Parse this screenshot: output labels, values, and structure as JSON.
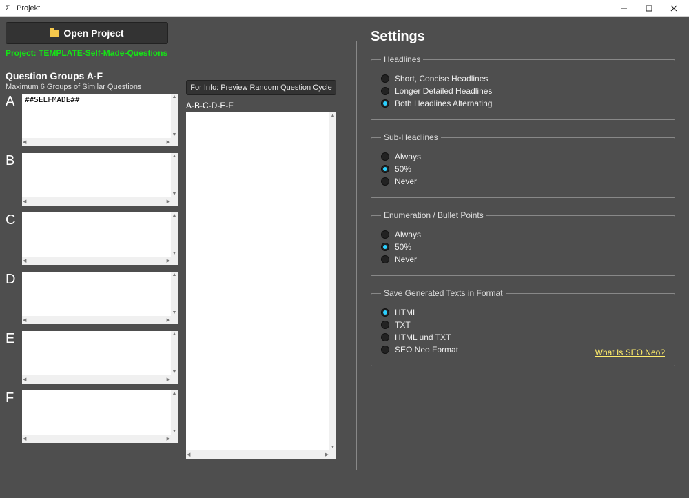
{
  "window": {
    "title": "Projekt"
  },
  "toolbar": {
    "open_project": "Open Project"
  },
  "project_line": "Project: TEMPLATE-Self-Made-Questions",
  "groups": {
    "title": "Question Groups A-F",
    "subtitle": "Maximum 6 Groups of Similar Questions",
    "letters": [
      "A",
      "B",
      "C",
      "D",
      "E",
      "F"
    ],
    "contents": [
      "##SELFMADE##",
      "",
      "",
      "",
      "",
      ""
    ]
  },
  "preview": {
    "button": "For Info: Preview Random Question Cycle",
    "label": "A-B-C-D-E-F",
    "content": ""
  },
  "settings": {
    "title": "Settings",
    "headlines": {
      "legend": "Headlines",
      "options": [
        "Short, Concise Headlines",
        "Longer Detailed Headlines",
        "Both Headlines Alternating"
      ],
      "selected": 2
    },
    "subheadlines": {
      "legend": "Sub-Headlines",
      "options": [
        "Always",
        "50%",
        "Never"
      ],
      "selected": 1
    },
    "enumeration": {
      "legend": "Enumeration / Bullet Points",
      "options": [
        "Always",
        "50%",
        "Never"
      ],
      "selected": 1
    },
    "format": {
      "legend": "Save Generated Texts in Format",
      "options": [
        "HTML",
        "TXT",
        "HTML und TXT",
        "SEO Neo Format"
      ],
      "selected": 0,
      "seo_link": "What Is SEO Neo?"
    }
  }
}
